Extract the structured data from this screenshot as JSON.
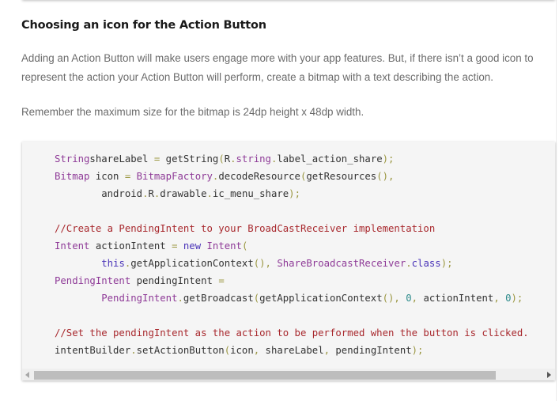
{
  "section": {
    "heading": "Choosing an icon for the Action Button",
    "paragraphs": [
      "Adding an Action Button will make users engage more with your app features. But, if there isn’t a good icon to represent the action your Action Button will perform, create a bitmap with a text describing the action.",
      "Remember the maximum size for the bitmap is 24dp height x 48dp width."
    ]
  },
  "code": {
    "language": "java",
    "lines": [
      [
        [
          "t",
          "String"
        ],
        [
          "",
          "shareLabel "
        ],
        [
          "p",
          "="
        ],
        [
          "",
          " getString"
        ],
        [
          "p",
          "("
        ],
        [
          "",
          "R"
        ],
        [
          "p",
          "."
        ],
        [
          "t",
          "string"
        ],
        [
          "p",
          "."
        ],
        [
          "",
          "label_action_share"
        ],
        [
          "p",
          ");"
        ]
      ],
      [
        [
          "t",
          "Bitmap"
        ],
        [
          "",
          " icon "
        ],
        [
          "p",
          "="
        ],
        [
          "",
          " "
        ],
        [
          "t",
          "BitmapFactory"
        ],
        [
          "p",
          "."
        ],
        [
          "",
          "decodeResource"
        ],
        [
          "p",
          "("
        ],
        [
          "",
          "getResources"
        ],
        [
          "p",
          "(),"
        ]
      ],
      [
        [
          "",
          "        android"
        ],
        [
          "p",
          "."
        ],
        [
          "",
          "R"
        ],
        [
          "p",
          "."
        ],
        [
          "",
          "drawable"
        ],
        [
          "p",
          "."
        ],
        [
          "",
          "ic_menu_share"
        ],
        [
          "p",
          ");"
        ]
      ],
      [],
      [
        [
          "c",
          "//Create a PendingIntent to your BroadCastReceiver implementation"
        ]
      ],
      [
        [
          "t",
          "Intent"
        ],
        [
          "",
          " actionIntent "
        ],
        [
          "p",
          "="
        ],
        [
          "",
          " "
        ],
        [
          "k",
          "new"
        ],
        [
          "",
          " "
        ],
        [
          "t",
          "Intent"
        ],
        [
          "p",
          "("
        ]
      ],
      [
        [
          "",
          "        "
        ],
        [
          "k",
          "this"
        ],
        [
          "p",
          "."
        ],
        [
          "",
          "getApplicationContext"
        ],
        [
          "p",
          "(),"
        ],
        [
          "",
          " "
        ],
        [
          "t",
          "ShareBroadcastReceiver"
        ],
        [
          "p",
          "."
        ],
        [
          "k",
          "class"
        ],
        [
          "p",
          ");"
        ]
      ],
      [
        [
          "t",
          "PendingIntent"
        ],
        [
          "",
          " pendingIntent "
        ],
        [
          "p",
          "="
        ]
      ],
      [
        [
          "",
          "        "
        ],
        [
          "t",
          "PendingIntent"
        ],
        [
          "p",
          "."
        ],
        [
          "",
          "getBroadcast"
        ],
        [
          "p",
          "("
        ],
        [
          "",
          "getApplicationContext"
        ],
        [
          "p",
          "(),"
        ],
        [
          "",
          " "
        ],
        [
          "n",
          "0"
        ],
        [
          "p",
          ","
        ],
        [
          "",
          " actionIntent"
        ],
        [
          "p",
          ","
        ],
        [
          "",
          " "
        ],
        [
          "n",
          "0"
        ],
        [
          "p",
          ");"
        ]
      ],
      [],
      [
        [
          "c",
          "//Set the pendingIntent as the action to be performed when the button is clicked."
        ]
      ],
      [
        [
          "",
          "intentBuilder"
        ],
        [
          "p",
          "."
        ],
        [
          "",
          "setActionButton"
        ],
        [
          "p",
          "("
        ],
        [
          "",
          "icon"
        ],
        [
          "p",
          ","
        ],
        [
          "",
          " shareLabel"
        ],
        [
          "p",
          ","
        ],
        [
          "",
          " pendingIntent"
        ],
        [
          "p",
          ");"
        ]
      ]
    ]
  },
  "scrollbar": {
    "left_icon": "arrow-left-icon",
    "right_icon": "arrow-right-icon"
  },
  "colors": {
    "type": "#8e3a97",
    "keyword": "#4a34b8",
    "punctuation": "#9a9640",
    "comment": "#a8282d",
    "number": "#2e8b8b"
  }
}
